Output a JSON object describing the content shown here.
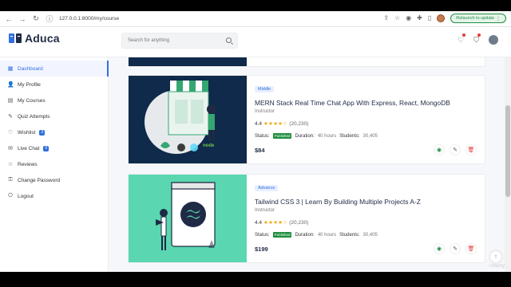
{
  "browser": {
    "url": "127.0.0.1:8000/my/course",
    "relaunch_label": "Relaunch to update"
  },
  "app": {
    "logo_text": "Aduca",
    "search_placeholder": "Search for anything"
  },
  "sidebar": {
    "items": [
      {
        "label": "Dashboard",
        "icon": "dashboard-icon"
      },
      {
        "label": "My Profile",
        "icon": "user-icon"
      },
      {
        "label": "My Courses",
        "icon": "book-icon"
      },
      {
        "label": "Quiz Attempts",
        "icon": "pencil-icon"
      },
      {
        "label": "Wishlist",
        "icon": "heart-icon",
        "badge": "3"
      },
      {
        "label": "Live Chat",
        "icon": "chat-icon",
        "badge": "0"
      },
      {
        "label": "Reviews",
        "icon": "star-icon"
      },
      {
        "label": "Change Password",
        "icon": "lock-icon"
      },
      {
        "label": "Logout",
        "icon": "power-icon"
      }
    ]
  },
  "courses": [
    {
      "level": "Middle",
      "title": "MERN Stack Real Time Chat App With Express, React, MongoDB",
      "role": "Instructor",
      "rating": "4.4",
      "reviews": "(20,230)",
      "status_label": "Status:",
      "status": "Published",
      "duration_label": "Duration:",
      "duration": "40 hours",
      "students_label": "Students:",
      "students": "30,405",
      "price": "$84"
    },
    {
      "level": "Advance",
      "title": "Tailwind CSS 3 | Learn By Building Multiple Projects A-Z",
      "role": "Instructor",
      "rating": "4.4",
      "reviews": "(20,230)",
      "status_label": "Status:",
      "status": "Published",
      "duration_label": "Duration:",
      "duration": "40 hours",
      "students_label": "Students:",
      "students": "30,405",
      "price": "$199"
    }
  ],
  "thumb_labels": {
    "node": "node"
  },
  "watermark": "Udemy",
  "colors": {
    "accent": "#2f6fdf",
    "published": "#1e8e3e",
    "star": "#f0a500",
    "mern_bg": "#0f2a4a",
    "tailwind_bg": "#5ad7b0"
  }
}
